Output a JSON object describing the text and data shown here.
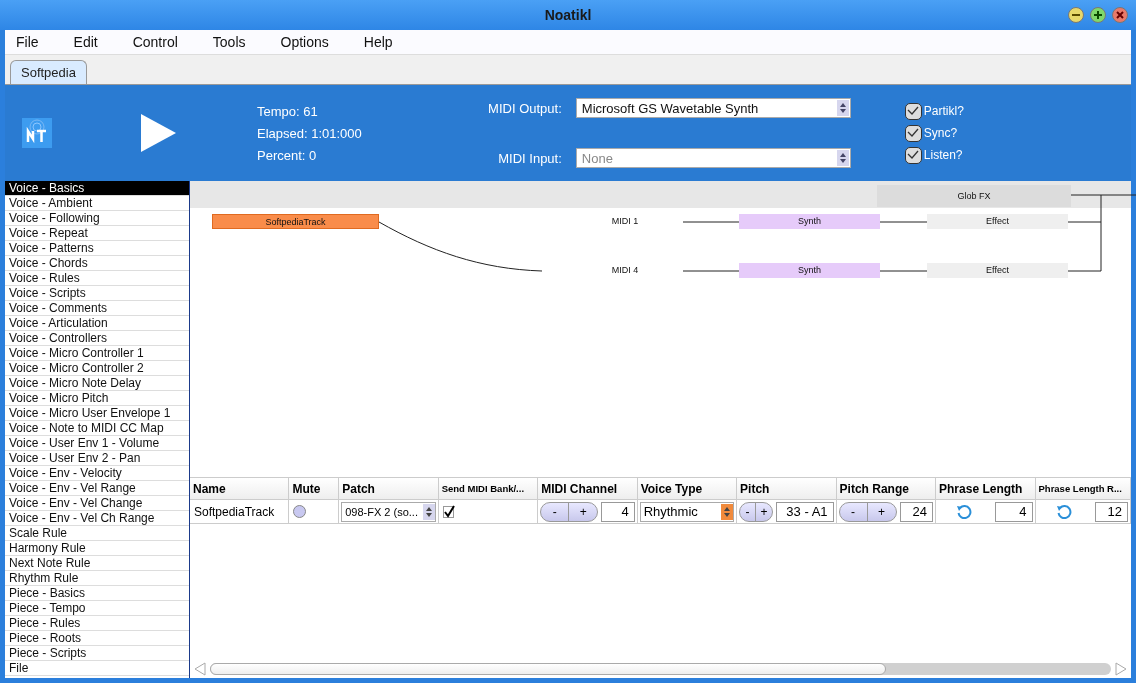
{
  "window": {
    "title": "Noatikl"
  },
  "menu": [
    "File",
    "Edit",
    "Control",
    "Tools",
    "Options",
    "Help"
  ],
  "tabs": [
    {
      "label": "Softpedia",
      "selected": true
    }
  ],
  "transport": {
    "tempo": "Tempo: 61",
    "elapsed": "Elapsed: 1:01:000",
    "percent": "Percent: 0"
  },
  "midi": [
    {
      "label": "MIDI Output:",
      "value": "Microsoft GS Wavetable Synth",
      "disabled": false
    },
    {
      "label": "MIDI Input:",
      "value": "None",
      "disabled": true
    }
  ],
  "options": [
    {
      "label": "Partikl?",
      "checked": true
    },
    {
      "label": "Sync?",
      "checked": true
    },
    {
      "label": "Listen?",
      "checked": true
    }
  ],
  "sidebar": {
    "items": [
      {
        "label": "Voice - Basics",
        "selected": true
      },
      {
        "label": "Voice - Ambient",
        "selected": false
      },
      {
        "label": "Voice - Following",
        "selected": false
      },
      {
        "label": "Voice - Repeat",
        "selected": false
      },
      {
        "label": "Voice - Patterns",
        "selected": false
      },
      {
        "label": "Voice - Chords",
        "selected": false
      },
      {
        "label": "Voice - Rules",
        "selected": false
      },
      {
        "label": "Voice - Scripts",
        "selected": false
      },
      {
        "label": "Voice - Comments",
        "selected": false
      },
      {
        "label": "Voice - Articulation",
        "selected": false
      },
      {
        "label": "Voice - Controllers",
        "selected": false
      },
      {
        "label": "Voice - Micro Controller 1",
        "selected": false
      },
      {
        "label": "Voice - Micro Controller 2",
        "selected": false
      },
      {
        "label": "Voice - Micro Note Delay",
        "selected": false
      },
      {
        "label": "Voice - Micro Pitch",
        "selected": false
      },
      {
        "label": "Voice - Micro User Envelope 1",
        "selected": false
      },
      {
        "label": "Voice - Note to MIDI CC Map",
        "selected": false
      },
      {
        "label": "Voice - User Env 1 - Volume",
        "selected": false
      },
      {
        "label": "Voice - User Env 2 - Pan",
        "selected": false
      },
      {
        "label": "Voice - Env - Velocity",
        "selected": false
      },
      {
        "label": "Voice - Env - Vel Range",
        "selected": false
      },
      {
        "label": "Voice - Env - Vel Change",
        "selected": false
      },
      {
        "label": "Voice - Env - Vel Ch Range",
        "selected": false
      },
      {
        "label": "Scale Rule",
        "selected": false
      },
      {
        "label": "Harmony Rule",
        "selected": false
      },
      {
        "label": "Next Note Rule",
        "selected": false
      },
      {
        "label": "Rhythm Rule",
        "selected": false
      },
      {
        "label": "Piece - Basics",
        "selected": false
      },
      {
        "label": "Piece - Tempo",
        "selected": false
      },
      {
        "label": "Piece - Rules",
        "selected": false
      },
      {
        "label": "Piece - Roots",
        "selected": false
      },
      {
        "label": "Piece - Scripts",
        "selected": false
      },
      {
        "label": "File",
        "selected": false
      }
    ]
  },
  "graph": {
    "nodes": [
      {
        "kind": "globfx",
        "label": "Glob FX"
      },
      {
        "kind": "track",
        "label": "SoftpediaTrack"
      },
      {
        "kind": "midi",
        "label": "MIDI 1"
      },
      {
        "kind": "synth",
        "label": "Synth"
      },
      {
        "kind": "effect",
        "label": "Effect"
      },
      {
        "kind": "midi",
        "label": "MIDI 4"
      },
      {
        "kind": "synth",
        "label": "Synth"
      },
      {
        "kind": "effect",
        "label": "Effect"
      }
    ]
  },
  "table": {
    "columns": [
      "Name",
      "Mute",
      "Patch",
      "Send MIDI Bank/...",
      "MIDI Channel",
      "Voice Type",
      "Pitch",
      "Pitch Range",
      "Phrase Length",
      "Phrase Length R..."
    ],
    "rows": [
      [
        {
          "kind": "text",
          "value": "SoftpediaTrack"
        },
        {
          "kind": "radio",
          "on": false
        },
        {
          "kind": "select",
          "value": "098-FX 2 (so...",
          "highlighted": false
        },
        {
          "kind": "check",
          "checked": true
        },
        {
          "kind": "stepper",
          "minus": "-",
          "plus": "+",
          "value": "4"
        },
        {
          "kind": "select",
          "value": "Rhythmic",
          "highlighted": true
        },
        {
          "kind": "stepper",
          "minus": "-",
          "plus": "+",
          "value": "33 - A1"
        },
        {
          "kind": "stepper",
          "minus": "-",
          "plus": "+",
          "value": "24"
        },
        {
          "kind": "reset",
          "value": "4"
        },
        {
          "kind": "reset",
          "value": "12"
        }
      ]
    ]
  }
}
